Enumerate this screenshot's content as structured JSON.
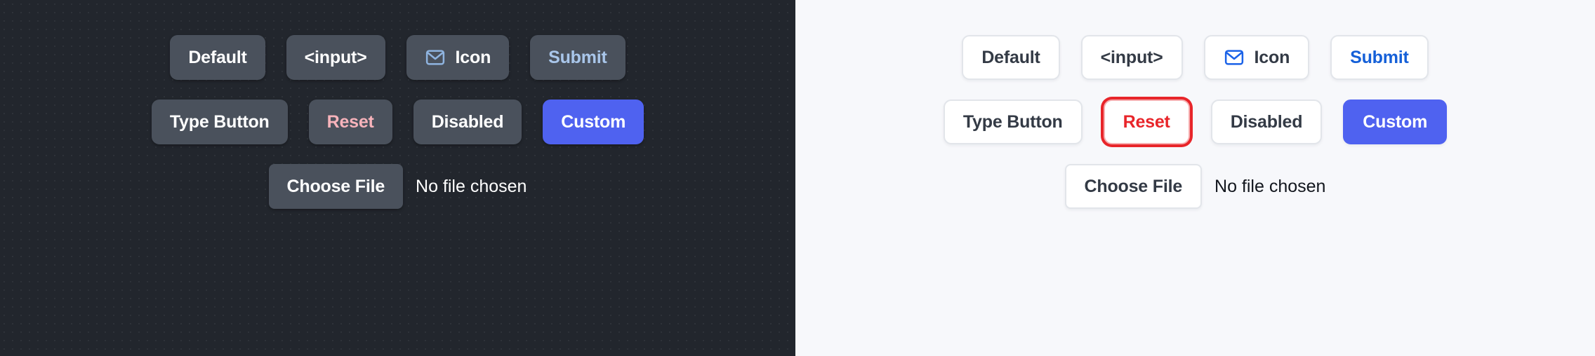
{
  "panels": [
    {
      "theme": "dark",
      "background": "#22262d",
      "rows": {
        "primary": [
          {
            "label": "Default",
            "variant": "default"
          },
          {
            "label": "<input>",
            "variant": "input"
          },
          {
            "label": "Icon",
            "variant": "icon",
            "icon": "mail-icon"
          },
          {
            "label": "Submit",
            "variant": "submit"
          }
        ],
        "secondary": [
          {
            "label": "Type Button",
            "variant": "type-button"
          },
          {
            "label": "Reset",
            "variant": "reset"
          },
          {
            "label": "Disabled",
            "variant": "disabled"
          },
          {
            "label": "Custom",
            "variant": "custom"
          }
        ],
        "file": {
          "button_label": "Choose File",
          "status": "No file chosen"
        }
      },
      "colors": {
        "button_bg": "#4a515c",
        "button_text": "#ffffff",
        "submit_text": "#a9c6ea",
        "reset_text": "#f7b3bb",
        "custom_bg": "#4f62f0",
        "icon_stroke": "#8fb4e0"
      }
    },
    {
      "theme": "light",
      "background": "#f7f8fb",
      "rows": {
        "primary": [
          {
            "label": "Default",
            "variant": "default"
          },
          {
            "label": "<input>",
            "variant": "input"
          },
          {
            "label": "Icon",
            "variant": "icon",
            "icon": "mail-icon"
          },
          {
            "label": "Submit",
            "variant": "submit"
          }
        ],
        "secondary": [
          {
            "label": "Type Button",
            "variant": "type-button"
          },
          {
            "label": "Reset",
            "variant": "reset",
            "state": "focused"
          },
          {
            "label": "Disabled",
            "variant": "disabled"
          },
          {
            "label": "Custom",
            "variant": "custom"
          }
        ],
        "file": {
          "button_label": "Choose File",
          "status": "No file chosen"
        }
      },
      "colors": {
        "button_bg": "#ffffff",
        "button_border": "#e2e5ea",
        "button_text": "#333a45",
        "submit_text": "#1560d8",
        "reset_text": "#e8252a",
        "reset_ring": "#e8252a",
        "reset_inner_ring": "#f6aeb0",
        "custom_bg": "#4f62f0",
        "icon_stroke": "#1a62e8"
      }
    }
  ]
}
